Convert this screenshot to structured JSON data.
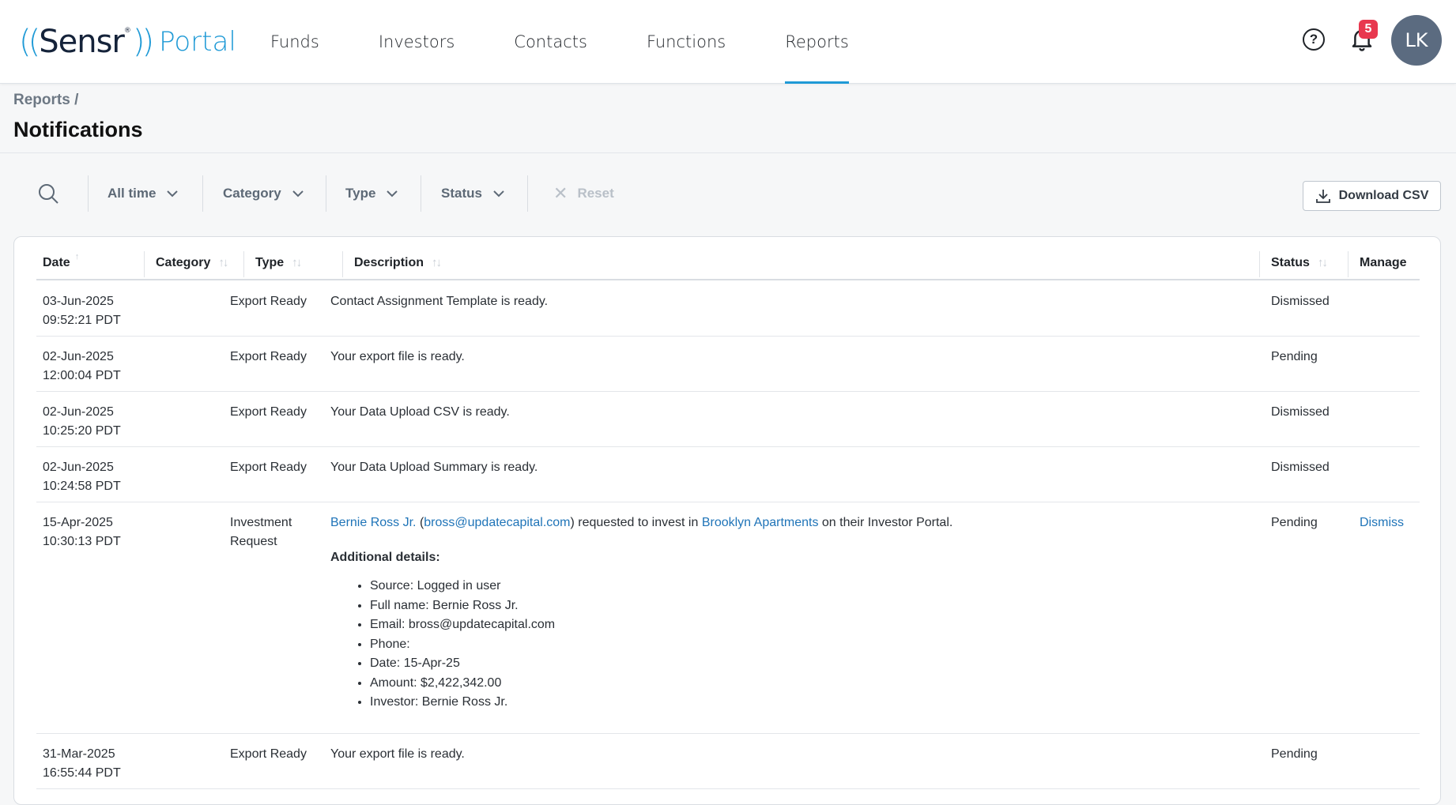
{
  "brand": {
    "paren_open": "((",
    "name": "Sensr",
    "reg": "®",
    "paren_close": "))",
    "product": "Portal"
  },
  "nav": {
    "items": [
      "Funds",
      "Investors",
      "Contacts",
      "Functions",
      "Reports"
    ],
    "active": "Reports"
  },
  "header": {
    "help": "?",
    "notification_count": "5",
    "avatar_initials": "LK"
  },
  "page": {
    "breadcrumb": "Reports /",
    "title": "Notifications"
  },
  "filters": {
    "time": "All time",
    "category": "Category",
    "type": "Type",
    "status": "Status",
    "reset": "Reset",
    "download": "Download CSV"
  },
  "table": {
    "columns": {
      "date": "Date",
      "category": "Category",
      "type": "Type",
      "description": "Description",
      "status": "Status",
      "manage": "Manage"
    },
    "rows": [
      {
        "date": "03-Jun-2025",
        "time": "09:52:21 PDT",
        "type": "Export Ready",
        "description": "Contact Assignment Template is ready.",
        "status": "Dismissed"
      },
      {
        "date": "02-Jun-2025",
        "time": "12:00:04 PDT",
        "type": "Export Ready",
        "description": "Your export file is ready.",
        "status": "Pending"
      },
      {
        "date": "02-Jun-2025",
        "time": "10:25:20 PDT",
        "type": "Export Ready",
        "description": "Your Data Upload CSV is ready.",
        "status": "Dismissed"
      },
      {
        "date": "02-Jun-2025",
        "time": "10:24:58 PDT",
        "type": "Export Ready",
        "description": "Your Data Upload Summary is ready.",
        "status": "Dismissed"
      },
      {
        "date": "15-Apr-2025",
        "time": "10:30:13 PDT",
        "type_line1": "Investment",
        "type_line2": "Request",
        "investor": "Bernie Ross Jr.",
        "paren_open": "(",
        "email": "bross@updatecapital.com",
        "text_mid": ") requested to invest in",
        "fund": "Brooklyn Apartments",
        "text_end": "on their Investor Portal.",
        "details_title": "Additional details:",
        "details": [
          "Source: Logged in user",
          "Full name: Bernie Ross Jr.",
          "Email: bross@updatecapital.com",
          "Phone:",
          "Date: 15-Apr-25",
          "Amount: $2,422,342.00",
          "Investor: Bernie Ross Jr."
        ],
        "status": "Pending",
        "manage": "Dismiss"
      },
      {
        "date": "31-Mar-2025",
        "time": "16:55:44 PDT",
        "type": "Export Ready",
        "description": "Your export file is ready.",
        "status": "Pending"
      }
    ]
  }
}
